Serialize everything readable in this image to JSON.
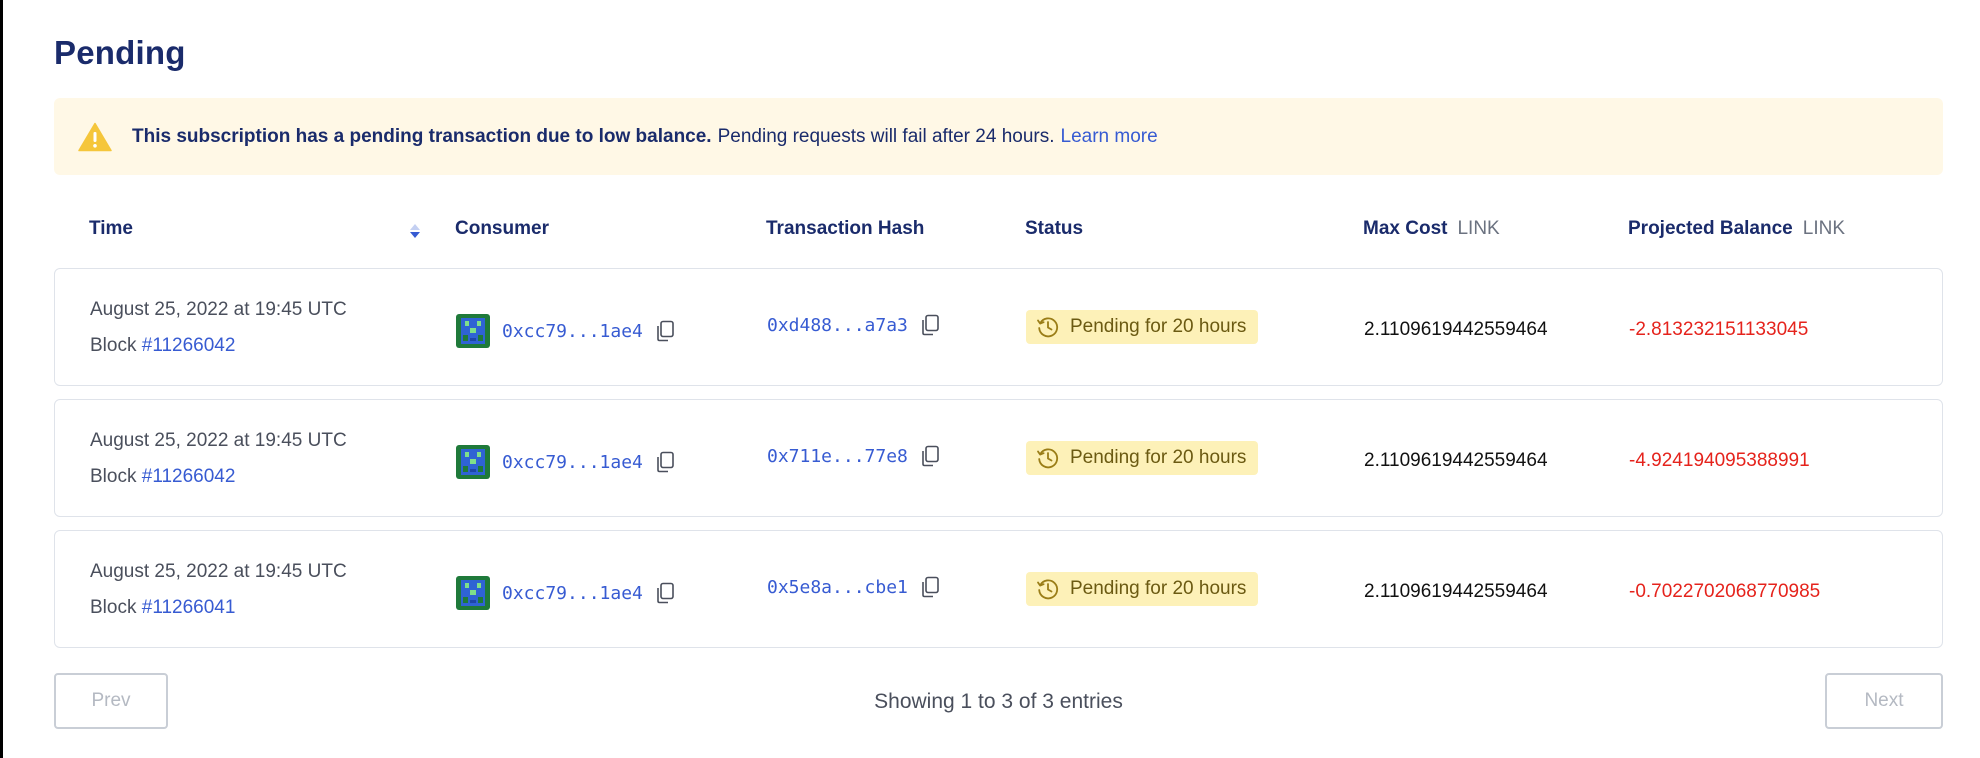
{
  "title": "Pending",
  "alert": {
    "icon": "warning-triangle-icon",
    "strong_text": "This subscription has a pending transaction due to low balance.",
    "text": "Pending requests will fail after 24 hours.",
    "link_text": "Learn more"
  },
  "table": {
    "columns": {
      "time": "Time",
      "consumer": "Consumer",
      "hash": "Transaction Hash",
      "status": "Status",
      "max_cost": "Max Cost",
      "max_cost_unit": "LINK",
      "projected": "Projected Balance",
      "projected_unit": "LINK"
    },
    "rows": [
      {
        "date": "August 25, 2022 at 19:45 UTC",
        "block_label": "Block",
        "block": "#11266042",
        "consumer": "0xcc79...1ae4",
        "hash": "0xd488...a7a3",
        "status": "Pending for 20 hours",
        "max_cost": "2.1109619442559464",
        "projected": "-2.813232151133045"
      },
      {
        "date": "August 25, 2022 at 19:45 UTC",
        "block_label": "Block",
        "block": "#11266042",
        "consumer": "0xcc79...1ae4",
        "hash": "0x711e...77e8",
        "status": "Pending for 20 hours",
        "max_cost": "2.1109619442559464",
        "projected": "-4.924194095388991"
      },
      {
        "date": "August 25, 2022 at 19:45 UTC",
        "block_label": "Block",
        "block": "#11266041",
        "consumer": "0xcc79...1ae4",
        "hash": "0x5e8a...cbe1",
        "status": "Pending for 20 hours",
        "max_cost": "2.1109619442559464",
        "projected": "-0.7022702068770985"
      }
    ]
  },
  "pagination": {
    "prev": "Prev",
    "next": "Next",
    "showing": "Showing 1 to 3 of 3 entries"
  },
  "colors": {
    "title": "#1a2b6b",
    "link": "#375bd2",
    "alert_bg": "#fff8e6",
    "warning": "#f5c63b",
    "status_bg": "#fdf1b8",
    "negative": "#e5231c"
  }
}
